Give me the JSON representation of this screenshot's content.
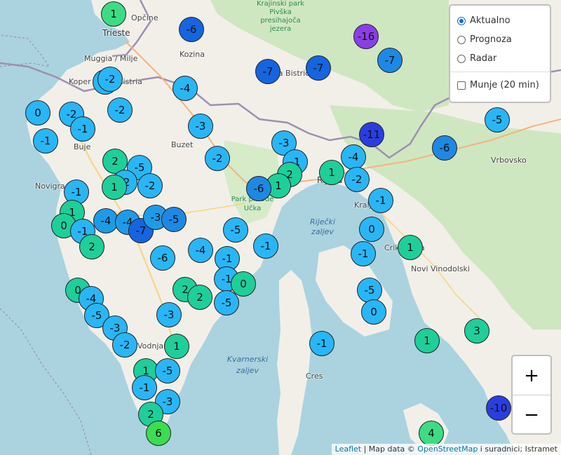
{
  "places": {
    "trieste": "Trieste",
    "opcine": "Opčine",
    "muggia": "Muggia / Milje",
    "koper": "Koper / Capodistria",
    "kozina": "Kozina",
    "ilirska_bistrica": "Ilirska Bistrica",
    "buje": "Buje",
    "buzet": "Buzet",
    "novigrad": "Novigrad",
    "rijeka": "Rijeka",
    "kraljevica": "Kraljevica",
    "crikvenica": "Crikvenica",
    "novi_vinodolski": "Novi Vinodolski",
    "vrbovsko": "Vrbovsko",
    "cres": "Cres",
    "vodnjan": "Vodnjan",
    "kvarner": "Kvarnerski zaljev",
    "rijecki_zaljev": "Riječki zaljev",
    "park_ucka": "Park prirode Učka",
    "park_pivka": "Krajinski park Pivška presihajoča jezera"
  },
  "layers": {
    "options": [
      "Aktualno",
      "Prognoza",
      "Radar"
    ],
    "selected": "Aktualno",
    "overlay": "Munje (20 min)",
    "overlay_checked": false
  },
  "zoom": {
    "in": "+",
    "out": "−"
  },
  "attribution": {
    "leaflet": "Leaflet",
    "sep": " | Map data © ",
    "osm": "OpenStreetMap",
    "rest": " i suradnici; Istramet"
  },
  "stations": [
    {
      "t": "1",
      "c": "#3ddc84"
    },
    {
      "t": "-6",
      "c": "#1565e0"
    },
    {
      "t": "-16",
      "c": "#8a3ee8"
    },
    {
      "t": "-7",
      "c": "#1e88e5"
    },
    {
      "t": "-7",
      "c": "#1565e0"
    },
    {
      "t": "-7",
      "c": "#1565e0"
    },
    {
      "t": "-2",
      "c": "#29b6f6"
    },
    {
      "t": "-2",
      "c": "#29b6f6"
    },
    {
      "t": "-4",
      "c": "#29b6f6"
    },
    {
      "t": "0",
      "c": "#29b6f6"
    },
    {
      "t": "-2",
      "c": "#29b6f6"
    },
    {
      "t": "-2",
      "c": "#29b6f6"
    },
    {
      "t": "-1",
      "c": "#29b6f6"
    },
    {
      "t": "-1",
      "c": "#29b6f6"
    },
    {
      "t": "-3",
      "c": "#29b6f6"
    },
    {
      "t": "-11",
      "c": "#2a3ee0"
    },
    {
      "t": "-5",
      "c": "#29b6f6"
    },
    {
      "t": "-6",
      "c": "#1e88e5"
    },
    {
      "t": "2",
      "c": "#1ecf9a"
    },
    {
      "t": "-5",
      "c": "#29b6f6"
    },
    {
      "t": "-2",
      "c": "#29b6f6"
    },
    {
      "t": "-2",
      "c": "#29b6f6"
    },
    {
      "t": "-2",
      "c": "#29b6f6"
    },
    {
      "t": "-3",
      "c": "#29b6f6"
    },
    {
      "t": "-1",
      "c": "#29b6f6"
    },
    {
      "t": "2",
      "c": "#1ecf9a"
    },
    {
      "t": "1",
      "c": "#1ecf9a"
    },
    {
      "t": "-6",
      "c": "#1e88e5"
    },
    {
      "t": "1",
      "c": "#1ecf9a"
    },
    {
      "t": "-4",
      "c": "#29b6f6"
    },
    {
      "t": "1",
      "c": "#1ecf9a"
    },
    {
      "t": "-2",
      "c": "#29b6f6"
    },
    {
      "t": "-1",
      "c": "#29b6f6"
    },
    {
      "t": "-1",
      "c": "#29b6f6"
    },
    {
      "t": "1",
      "c": "#1ecf9a"
    },
    {
      "t": "0",
      "c": "#1ecf9a"
    },
    {
      "t": "-1",
      "c": "#29b6f6"
    },
    {
      "t": "-4",
      "c": "#1e9be8"
    },
    {
      "t": "-4",
      "c": "#1e9be8"
    },
    {
      "t": "-7",
      "c": "#1565e0"
    },
    {
      "t": "-3",
      "c": "#1e9be8"
    },
    {
      "t": "-5",
      "c": "#1e88e5"
    },
    {
      "t": "2",
      "c": "#1ecf9a"
    },
    {
      "t": "-5",
      "c": "#29b6f6"
    },
    {
      "t": "-1",
      "c": "#29b6f6"
    },
    {
      "t": "0",
      "c": "#29b6f6"
    },
    {
      "t": "1",
      "c": "#1ecf9a"
    },
    {
      "t": "-6",
      "c": "#29b6f6"
    },
    {
      "t": "-4",
      "c": "#29b6f6"
    },
    {
      "t": "-1",
      "c": "#29b6f6"
    },
    {
      "t": "-1",
      "c": "#29b6f6"
    },
    {
      "t": "-1",
      "c": "#29b6f6"
    },
    {
      "t": "0",
      "c": "#1ecf9a"
    },
    {
      "t": "-4",
      "c": "#29b6f6"
    },
    {
      "t": "-5",
      "c": "#29b6f6"
    },
    {
      "t": "2",
      "c": "#1ecf9a"
    },
    {
      "t": "2",
      "c": "#1ecf9a"
    },
    {
      "t": "0",
      "c": "#1ecf9a"
    },
    {
      "t": "-5",
      "c": "#29b6f6"
    },
    {
      "t": "-5",
      "c": "#29b6f6"
    },
    {
      "t": "-3",
      "c": "#29b6f6"
    },
    {
      "t": "0",
      "c": "#29b6f6"
    },
    {
      "t": "-3",
      "c": "#29b6f6"
    },
    {
      "t": "-2",
      "c": "#29b6f6"
    },
    {
      "t": "1",
      "c": "#1ecf9a"
    },
    {
      "t": "-1",
      "c": "#29b6f6"
    },
    {
      "t": "1",
      "c": "#1ecf9a"
    },
    {
      "t": "3",
      "c": "#1ecf9a"
    },
    {
      "t": "1",
      "c": "#1ecf9a"
    },
    {
      "t": "-5",
      "c": "#29b6f6"
    },
    {
      "t": "-1",
      "c": "#29b6f6"
    },
    {
      "t": "-3",
      "c": "#29b6f6"
    },
    {
      "t": "2",
      "c": "#1ecf9a"
    },
    {
      "t": "6",
      "c": "#3ddc52"
    },
    {
      "t": "4",
      "c": "#3ddc84"
    },
    {
      "t": "-10",
      "c": "#2a3ee0"
    }
  ]
}
